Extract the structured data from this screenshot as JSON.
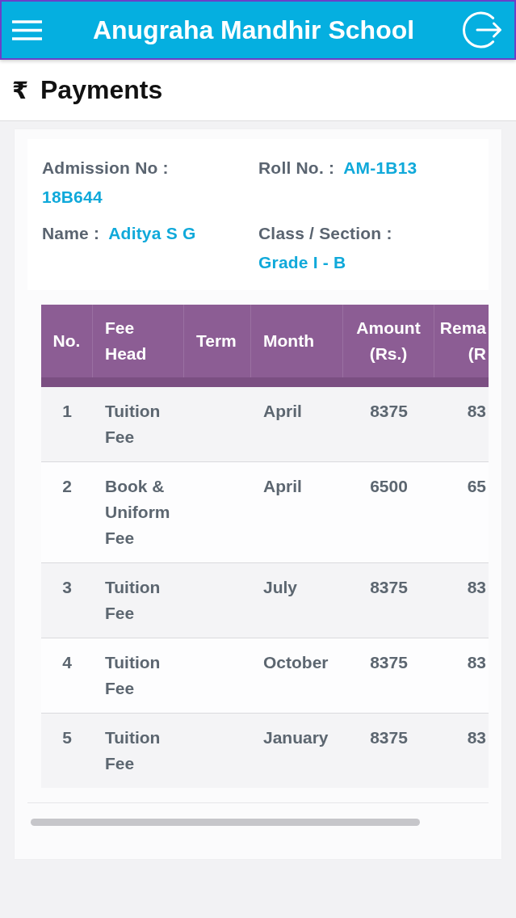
{
  "app_bar": {
    "title": "Anugraha Mandhir School"
  },
  "page_header": {
    "icon": "₹",
    "title": "Payments"
  },
  "student_info": [
    {
      "label": "Admission No :",
      "value": "18B644"
    },
    {
      "label": "Roll No. :",
      "value": "AM-1B13"
    },
    {
      "label": "Name :",
      "value": "Aditya S G"
    },
    {
      "label": "Class / Section :",
      "value": "Grade I - B"
    }
  ],
  "fees_table": {
    "columns": [
      "No.",
      "Fee Head",
      "Term",
      "Month",
      "Amount (Rs.)",
      "Rema (R"
    ],
    "rows": [
      {
        "no": "1",
        "fee_head": "Tuition Fee",
        "month": "April",
        "amount": "8375",
        "column_6": "83"
      },
      {
        "no": "2",
        "fee_head": "Book & Uniform Fee",
        "month": "April",
        "amount": "6500",
        "column_6": "65"
      },
      {
        "no": "3",
        "fee_head": "Tuition Fee",
        "month": "July",
        "amount": "8375",
        "column_6": "83"
      },
      {
        "no": "4",
        "fee_head": "Tuition Fee",
        "month": "October",
        "amount": "8375",
        "column_6": "83"
      },
      {
        "no": "5",
        "fee_head": "Tuition Fee",
        "month": "January",
        "amount": "8375",
        "column_6": "83"
      }
    ]
  }
}
